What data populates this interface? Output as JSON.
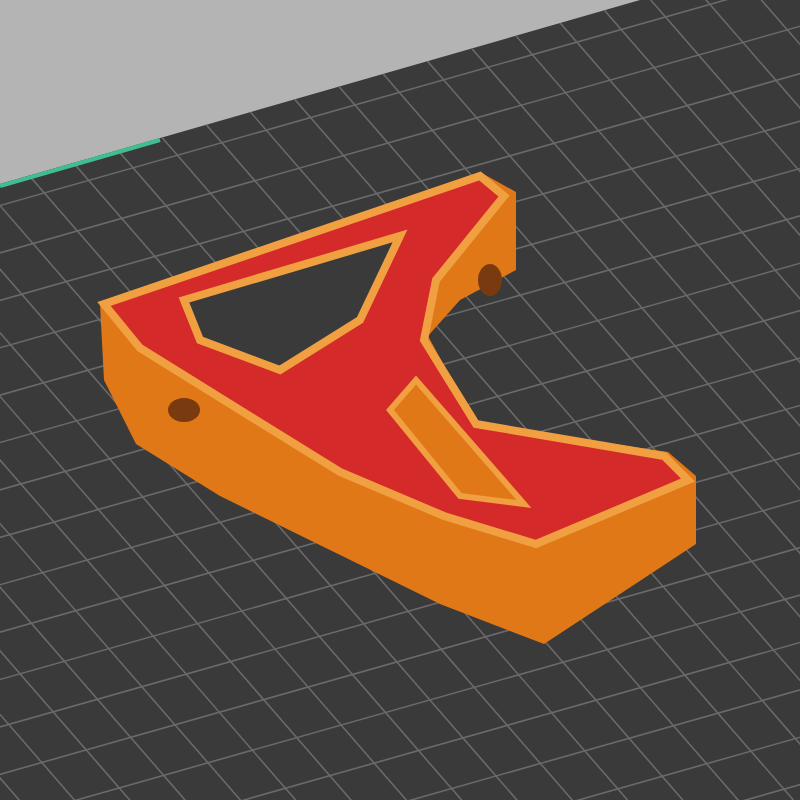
{
  "viewport": {
    "kind": "sliced-preview"
  }
}
